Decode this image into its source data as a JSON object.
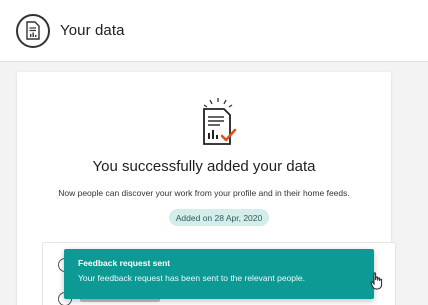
{
  "header": {
    "title": "Your data",
    "icon": "report-document-icon"
  },
  "success": {
    "icon": "report-checkmark-icon",
    "title": "You successfully added your data",
    "description": "Now people can discover your work from your profile and in their home feeds.",
    "date_badge": "Added on 28 Apr, 2020"
  },
  "toast": {
    "title": "Feedback request sent",
    "message": "Your feedback request has been sent to the relevant people."
  },
  "colors": {
    "accent": "#0d9a94",
    "badge_bg": "#d4ecea",
    "badge_text": "#2e5e5b"
  }
}
